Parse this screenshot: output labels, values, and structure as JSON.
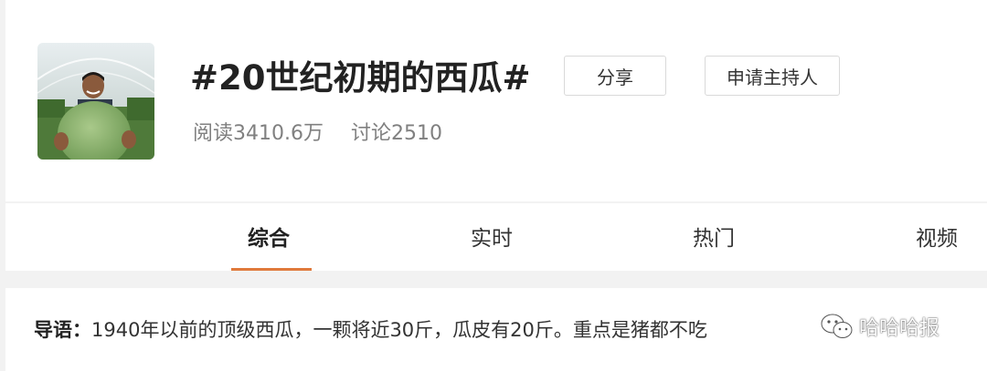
{
  "topic": {
    "title": "#20世纪初期的西瓜#",
    "share_label": "分享",
    "host_label": "申请主持人",
    "read_count": "阅读3410.6万",
    "discuss_count": "讨论2510"
  },
  "tabs": [
    {
      "label": "综合",
      "active": true
    },
    {
      "label": "实时",
      "active": false
    },
    {
      "label": "热门",
      "active": false
    },
    {
      "label": "视频",
      "active": false
    }
  ],
  "lead": {
    "label": "导语：",
    "text": "1940年以前的顶级西瓜，一颗将近30斤，瓜皮有20斤。重点是猪都不吃"
  },
  "watermark": {
    "icon": "wechat-icon",
    "text": "哈哈哈报"
  },
  "colors": {
    "accent": "#e07a3c",
    "background": "#f2f2f2",
    "panel": "#ffffff",
    "muted_text": "#808080"
  }
}
